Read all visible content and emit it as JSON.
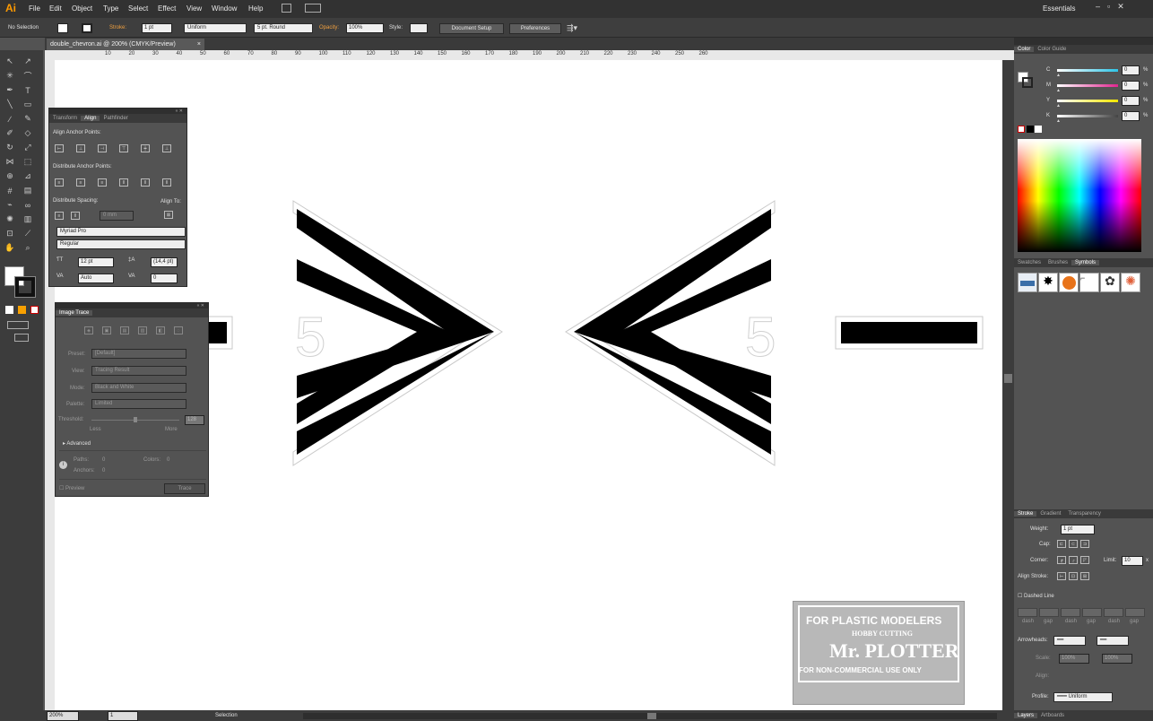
{
  "app": {
    "logo": "Ai"
  },
  "menu": [
    "File",
    "Edit",
    "Object",
    "Type",
    "Select",
    "Effect",
    "View",
    "Window",
    "Help"
  ],
  "workspace": "Essentials",
  "control": {
    "selection": "No Selection",
    "stroke_label": "Stroke:",
    "stroke_weight": "1 pt",
    "stroke_profile": "Uniform",
    "brush": "5 pt. Round",
    "opacity_label": "Opacity:",
    "opacity": "100%",
    "style_label": "Style:",
    "document_setup": "Document Setup",
    "preferences": "Preferences"
  },
  "document": {
    "tab": "double_chevron.ai @ 200% (CMYK/Preview)"
  },
  "ruler": [
    "10",
    "20",
    "30",
    "40",
    "50",
    "60",
    "70",
    "80",
    "90",
    "100",
    "110",
    "120",
    "130",
    "140",
    "150",
    "160",
    "170",
    "180",
    "190",
    "200",
    "210",
    "220",
    "230",
    "240",
    "250",
    "260"
  ],
  "align": {
    "tabs": [
      "Transform",
      "Align",
      "Pathfinder"
    ],
    "anchor_points": "Align Anchor Points:",
    "distribute_anchor": "Distribute Anchor Points:",
    "distribute_spacing": "Distribute Spacing:",
    "align_to": "Align To:",
    "spacing_value": "0 mm"
  },
  "character": {
    "font": "Myriad Pro",
    "style": "Regular",
    "size": "12 pt",
    "leading": "(14,4 pt)",
    "kerning": "Auto",
    "tracking": "0"
  },
  "image_trace": {
    "title": "Image Trace",
    "preset_label": "Preset:",
    "preset": "[Default]",
    "view_label": "View:",
    "view": "Tracing Result",
    "mode_label": "Mode:",
    "mode": "Black and White",
    "palette_label": "Palette:",
    "palette": "Limited",
    "threshold_label": "Threshold:",
    "threshold": "128",
    "less": "Less",
    "more": "More",
    "advanced": "Advanced",
    "paths_label": "Paths:",
    "paths": "0",
    "colors_label": "Colors:",
    "colors": "0",
    "anchors_label": "Anchors:",
    "anchors": "0",
    "preview": "Preview",
    "trace": "Trace"
  },
  "artwork": {
    "number": "5"
  },
  "color": {
    "tabs": [
      "Color",
      "Color Guide"
    ],
    "channels": [
      {
        "name": "C",
        "value": "0",
        "color": "#2ec4e6"
      },
      {
        "name": "M",
        "value": "0",
        "color": "#e0258f"
      },
      {
        "name": "Y",
        "value": "0",
        "color": "#f2e600"
      },
      {
        "name": "K",
        "value": "0",
        "color": "#444444"
      }
    ],
    "unit": "%"
  },
  "symbols": {
    "tabs": [
      "Swatches",
      "Brushes",
      "Symbols"
    ]
  },
  "stroke": {
    "tabs": [
      "Stroke",
      "Gradient",
      "Transparency"
    ],
    "weight_label": "Weight:",
    "weight": "1 pt",
    "cap_label": "Cap:",
    "corner_label": "Corner:",
    "limit_label": "Limit:",
    "limit": "10",
    "limit_unit": "x",
    "align_stroke_label": "Align Stroke:",
    "dashed_line": "Dashed Line",
    "dash_labels": [
      "dash",
      "gap",
      "dash",
      "gap",
      "dash",
      "gap"
    ],
    "arrowheads_label": "Arrowheads:",
    "scale_label": "Scale:",
    "scale1": "100%",
    "scale2": "100%",
    "align_label": "Align:",
    "profile_label": "Profile:",
    "profile": "Uniform"
  },
  "layers": {
    "tabs": [
      "Layers",
      "Artboards"
    ]
  },
  "status": {
    "zoom": "200%",
    "artboard": "1",
    "tool": "Selection"
  },
  "stamp": {
    "line1": "FOR PLASTIC MODELERS",
    "line2": "HOBBY CUTTING",
    "line3": "Mr. PLOTTER",
    "line4": "FOR NON-COMMERCIAL USE ONLY"
  }
}
